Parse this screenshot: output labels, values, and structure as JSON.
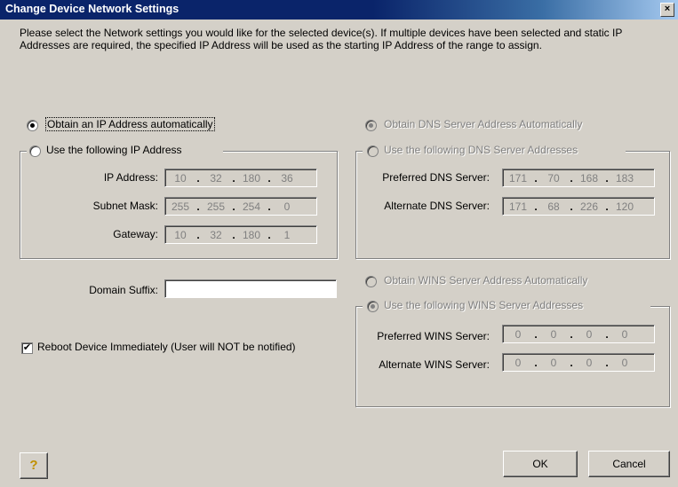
{
  "window": {
    "title": "Change Device Network Settings",
    "close_label": "×"
  },
  "intro_text": "Please select the Network settings you would like for the selected device(s).  If multiple devices have been selected and static IP Addresses are required, the specified IP Address will be used as the starting IP Address of the range to assign.",
  "ip": {
    "auto_label": "Obtain an IP Address automatically",
    "manual_label": "Use the following IP Address",
    "ip_address": {
      "label": "IP Address:",
      "octets": [
        "10",
        "32",
        "180",
        "36"
      ]
    },
    "subnet_mask": {
      "label": "Subnet Mask:",
      "octets": [
        "255",
        "255",
        "254",
        "0"
      ]
    },
    "gateway": {
      "label": "Gateway:",
      "octets": [
        "10",
        "32",
        "180",
        "1"
      ]
    }
  },
  "dns": {
    "auto_label": "Obtain DNS Server Address Automatically",
    "manual_label": "Use the following DNS Server Addresses",
    "preferred": {
      "label": "Preferred DNS Server:",
      "octets": [
        "171",
        "70",
        "168",
        "183"
      ]
    },
    "alternate": {
      "label": "Alternate DNS Server:",
      "octets": [
        "171",
        "68",
        "226",
        "120"
      ]
    }
  },
  "domain": {
    "label": "Domain Suffix:",
    "value": ""
  },
  "wins": {
    "auto_label": "Obtain WINS Server Address Automatically",
    "manual_label": "Use the following WINS Server Addresses",
    "preferred": {
      "label": "Preferred WINS Server:",
      "octets": [
        "0",
        "0",
        "0",
        "0"
      ]
    },
    "alternate": {
      "label": "Alternate WINS Server:",
      "octets": [
        "0",
        "0",
        "0",
        "0"
      ]
    }
  },
  "reboot": {
    "label": "Reboot Device Immediately (User will NOT be notified)",
    "checked": true,
    "check_glyph": "✔"
  },
  "buttons": {
    "help_glyph": "?",
    "ok_label": "OK",
    "cancel_label": "Cancel"
  }
}
